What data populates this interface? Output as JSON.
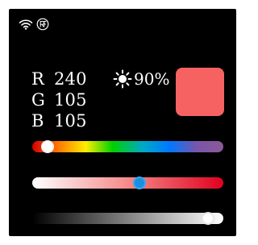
{
  "status_bar": {
    "icons": [
      "wifi-icon",
      "registered-icon"
    ]
  },
  "rgb": {
    "r": {
      "label": "R",
      "value": "240"
    },
    "g": {
      "label": "G",
      "value": "105"
    },
    "b": {
      "label": "B",
      "value": "105"
    }
  },
  "brightness": {
    "icon": "sun-icon",
    "value": "90%"
  },
  "swatch": {
    "color": "#f66262"
  },
  "sliders": {
    "hue": {
      "level": 0.08
    },
    "saturation": {
      "level": 0.56
    },
    "brightness": {
      "level": 0.92
    }
  },
  "colors": {
    "background": "#000000",
    "text": "#ffffff",
    "accent_blue": "#1a8fe0"
  }
}
